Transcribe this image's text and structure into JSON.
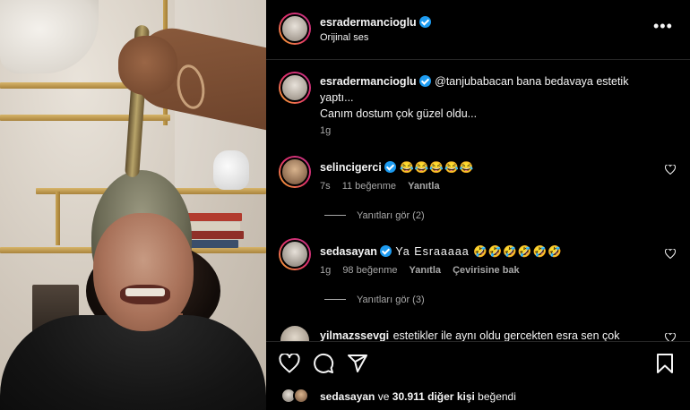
{
  "header": {
    "username": "esradermancioglu",
    "audio_label": "Orijinal ses",
    "more_label": "•••"
  },
  "caption": {
    "username": "esradermancioglu",
    "text_line1": "@tanjubabacan bana bedavaya estetik",
    "text_line2": "yaptı...",
    "text_line3": "Canım dostum çok güzel oldu...",
    "time": "1g"
  },
  "comments": [
    {
      "username": "selincigerci",
      "text": "😂😂😂😂😂",
      "time": "7s",
      "likes": "11 beğenme",
      "reply_label": "Yanıtla",
      "view_replies": "Yanıtları gör (2)"
    },
    {
      "username": "sedasayan",
      "text": "Ya Esraaaaa 🤣🤣🤣🤣🤣🤣",
      "time": "1g",
      "likes": "98 beğenme",
      "reply_label": "Yanıtla",
      "translate_label": "Çevirisine bak",
      "view_replies": "Yanıtları gör (3)"
    },
    {
      "username": "yilmazssevgi",
      "text": "estetikler ile aynı oldu gercekten esra sen çok"
    }
  ],
  "footer": {
    "liked_by_user": "sedasayan",
    "liked_connector": "ve",
    "liked_others": "30.911 diğer kişi",
    "liked_suffix": "beğendi"
  },
  "colors": {
    "background": "#000000",
    "text": "#f5f5f5",
    "muted": "#a8a8a8",
    "verified": "#1d9bf0",
    "divider": "#262626"
  },
  "icons": [
    "heart-icon",
    "comment-icon",
    "share-icon",
    "bookmark-icon",
    "more-icon",
    "verified-icon"
  ]
}
